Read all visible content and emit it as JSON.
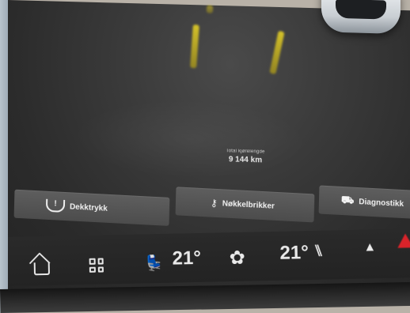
{
  "odometer": {
    "label": "Total kjørelengde",
    "value": "9 144 km"
  },
  "tiles": [
    {
      "label": "Dekktrykk",
      "icon": "tyre-pressure-icon",
      "icon_glyph": "!"
    },
    {
      "label": "Nøkkelbrikker",
      "icon": "key-fob-icon",
      "icon_glyph": "⚷"
    },
    {
      "label": "Diagnostikk",
      "icon": "diagnostics-icon",
      "icon_glyph": "⛟"
    }
  ],
  "dock": {
    "home_icon": "home-icon",
    "apps_icon": "apps-grid-icon",
    "left_seat_icon": "seat-heat-left-icon",
    "left_seat_glyph": "💺",
    "left_temp": "21°",
    "fan_icon": "fan-icon",
    "fan_glyph": "✿",
    "right_temp": "21°",
    "right_seat_icon": "seat-heat-right-icon",
    "right_seat_glyph": "⑊",
    "car_icon": "car-icon",
    "car_glyph": "▲",
    "hazard_icon": "hazard-icon"
  },
  "colors": {
    "screen_bg": "#2b2b2b",
    "tile_bg": "#555555",
    "lane_yellow": "#d8c228",
    "hazard_red": "#d9232a",
    "text": "#eaeaea"
  }
}
